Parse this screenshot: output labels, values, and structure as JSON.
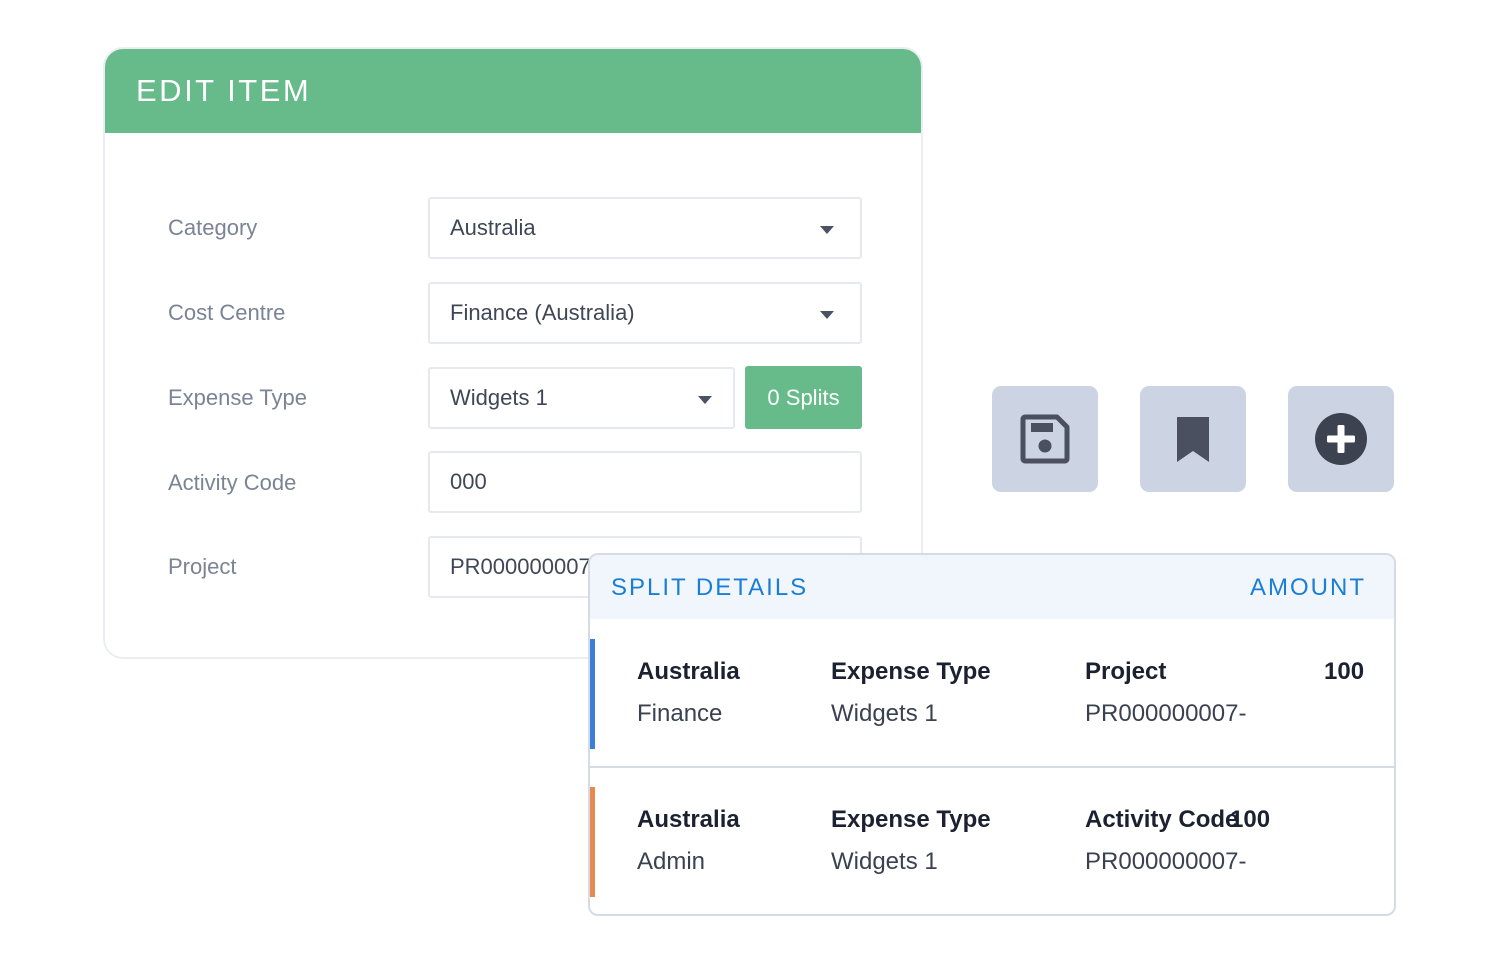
{
  "edit_item": {
    "title": "EDIT ITEM",
    "fields": [
      {
        "label": "Category",
        "value": "Australia"
      },
      {
        "label": "Cost Centre",
        "value": "Finance (Australia)"
      },
      {
        "label": "Expense Type",
        "value": "Widgets 1"
      },
      {
        "label": "Activity Code",
        "value": "000"
      },
      {
        "label": "Project",
        "value": "PR000000007-"
      }
    ],
    "splits_button": "0 Splits",
    "header_color": "#67bb8b"
  },
  "actions": [
    {
      "icon": "save-icon"
    },
    {
      "icon": "bookmark-icon"
    },
    {
      "icon": "plus-circle-icon"
    }
  ],
  "split_details": {
    "title": "SPLIT DETAILS",
    "amount_header": "AMOUNT",
    "rows": [
      {
        "accent": "#3b7fd8",
        "location": "Australia",
        "centre": "Finance",
        "type_label": "Expense Type",
        "type_value": "Widgets 1",
        "code_label": "Project",
        "code_value": "PR000000007-",
        "amount": "100"
      },
      {
        "accent": "#e8894f",
        "location": "Australia",
        "centre": "Admin",
        "type_label": "Expense Type",
        "type_value": "Widgets 1",
        "code_label": "Activity Code",
        "code_value": "PR000000007-",
        "amount": "100"
      }
    ]
  }
}
